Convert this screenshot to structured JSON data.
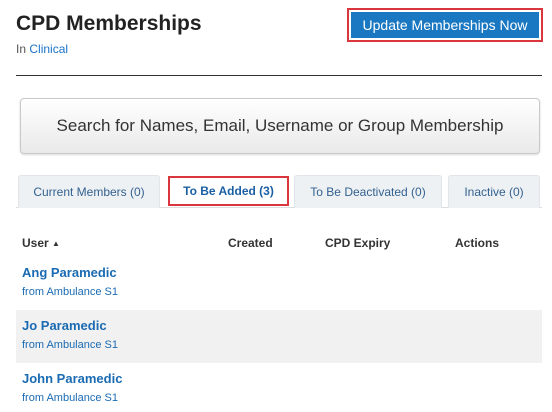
{
  "header": {
    "title": "CPD Memberships",
    "context_prefix": "In",
    "context_link": "Clinical",
    "update_button_label": "Update Memberships Now"
  },
  "search": {
    "label": "Search for Names, Email, Username or Group Membership"
  },
  "tabs": [
    {
      "label": "Current Members (0)",
      "active": false
    },
    {
      "label": "To Be Added (3)",
      "active": true
    },
    {
      "label": "To Be Deactivated (0)",
      "active": false
    },
    {
      "label": "Inactive (0)",
      "active": false
    }
  ],
  "table": {
    "columns": [
      "User",
      "Created",
      "CPD Expiry",
      "Actions"
    ],
    "sort_indicator": "▲",
    "rows": [
      {
        "name": "Ang Paramedic",
        "source": "from Ambulance S1"
      },
      {
        "name": "Jo Paramedic",
        "source": "from Ambulance S1"
      },
      {
        "name": "John Paramedic",
        "source": "from Ambulance S1"
      }
    ]
  },
  "colors": {
    "accent": "#1a78c2",
    "highlight": "#d9363e",
    "link": "#1a6bb3"
  }
}
